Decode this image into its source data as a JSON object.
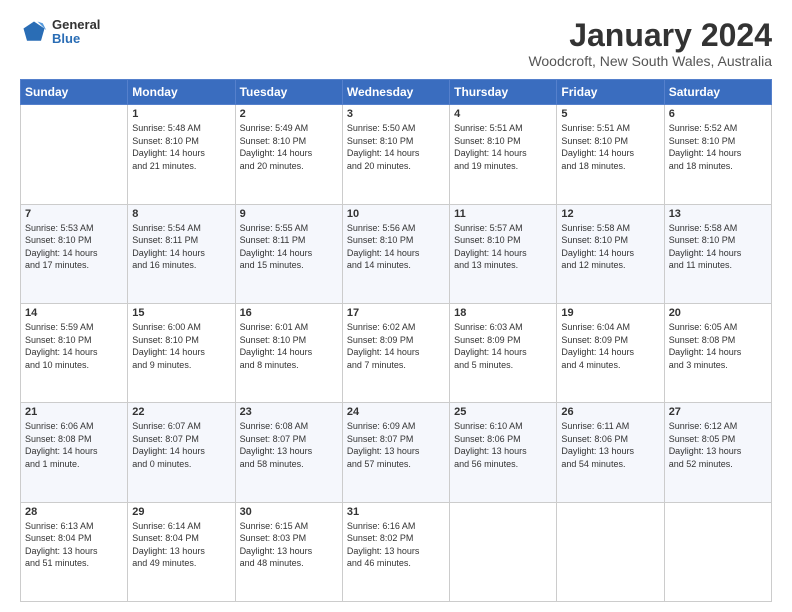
{
  "header": {
    "logo": {
      "general": "General",
      "blue": "Blue"
    },
    "title": "January 2024",
    "subtitle": "Woodcroft, New South Wales, Australia"
  },
  "weekdays": [
    "Sunday",
    "Monday",
    "Tuesday",
    "Wednesday",
    "Thursday",
    "Friday",
    "Saturday"
  ],
  "weeks": [
    [
      {
        "day": "",
        "info": ""
      },
      {
        "day": "1",
        "info": "Sunrise: 5:48 AM\nSunset: 8:10 PM\nDaylight: 14 hours\nand 21 minutes."
      },
      {
        "day": "2",
        "info": "Sunrise: 5:49 AM\nSunset: 8:10 PM\nDaylight: 14 hours\nand 20 minutes."
      },
      {
        "day": "3",
        "info": "Sunrise: 5:50 AM\nSunset: 8:10 PM\nDaylight: 14 hours\nand 20 minutes."
      },
      {
        "day": "4",
        "info": "Sunrise: 5:51 AM\nSunset: 8:10 PM\nDaylight: 14 hours\nand 19 minutes."
      },
      {
        "day": "5",
        "info": "Sunrise: 5:51 AM\nSunset: 8:10 PM\nDaylight: 14 hours\nand 18 minutes."
      },
      {
        "day": "6",
        "info": "Sunrise: 5:52 AM\nSunset: 8:10 PM\nDaylight: 14 hours\nand 18 minutes."
      }
    ],
    [
      {
        "day": "7",
        "info": "Sunrise: 5:53 AM\nSunset: 8:10 PM\nDaylight: 14 hours\nand 17 minutes."
      },
      {
        "day": "8",
        "info": "Sunrise: 5:54 AM\nSunset: 8:11 PM\nDaylight: 14 hours\nand 16 minutes."
      },
      {
        "day": "9",
        "info": "Sunrise: 5:55 AM\nSunset: 8:11 PM\nDaylight: 14 hours\nand 15 minutes."
      },
      {
        "day": "10",
        "info": "Sunrise: 5:56 AM\nSunset: 8:10 PM\nDaylight: 14 hours\nand 14 minutes."
      },
      {
        "day": "11",
        "info": "Sunrise: 5:57 AM\nSunset: 8:10 PM\nDaylight: 14 hours\nand 13 minutes."
      },
      {
        "day": "12",
        "info": "Sunrise: 5:58 AM\nSunset: 8:10 PM\nDaylight: 14 hours\nand 12 minutes."
      },
      {
        "day": "13",
        "info": "Sunrise: 5:58 AM\nSunset: 8:10 PM\nDaylight: 14 hours\nand 11 minutes."
      }
    ],
    [
      {
        "day": "14",
        "info": "Sunrise: 5:59 AM\nSunset: 8:10 PM\nDaylight: 14 hours\nand 10 minutes."
      },
      {
        "day": "15",
        "info": "Sunrise: 6:00 AM\nSunset: 8:10 PM\nDaylight: 14 hours\nand 9 minutes."
      },
      {
        "day": "16",
        "info": "Sunrise: 6:01 AM\nSunset: 8:10 PM\nDaylight: 14 hours\nand 8 minutes."
      },
      {
        "day": "17",
        "info": "Sunrise: 6:02 AM\nSunset: 8:09 PM\nDaylight: 14 hours\nand 7 minutes."
      },
      {
        "day": "18",
        "info": "Sunrise: 6:03 AM\nSunset: 8:09 PM\nDaylight: 14 hours\nand 5 minutes."
      },
      {
        "day": "19",
        "info": "Sunrise: 6:04 AM\nSunset: 8:09 PM\nDaylight: 14 hours\nand 4 minutes."
      },
      {
        "day": "20",
        "info": "Sunrise: 6:05 AM\nSunset: 8:08 PM\nDaylight: 14 hours\nand 3 minutes."
      }
    ],
    [
      {
        "day": "21",
        "info": "Sunrise: 6:06 AM\nSunset: 8:08 PM\nDaylight: 14 hours\nand 1 minute."
      },
      {
        "day": "22",
        "info": "Sunrise: 6:07 AM\nSunset: 8:07 PM\nDaylight: 14 hours\nand 0 minutes."
      },
      {
        "day": "23",
        "info": "Sunrise: 6:08 AM\nSunset: 8:07 PM\nDaylight: 13 hours\nand 58 minutes."
      },
      {
        "day": "24",
        "info": "Sunrise: 6:09 AM\nSunset: 8:07 PM\nDaylight: 13 hours\nand 57 minutes."
      },
      {
        "day": "25",
        "info": "Sunrise: 6:10 AM\nSunset: 8:06 PM\nDaylight: 13 hours\nand 56 minutes."
      },
      {
        "day": "26",
        "info": "Sunrise: 6:11 AM\nSunset: 8:06 PM\nDaylight: 13 hours\nand 54 minutes."
      },
      {
        "day": "27",
        "info": "Sunrise: 6:12 AM\nSunset: 8:05 PM\nDaylight: 13 hours\nand 52 minutes."
      }
    ],
    [
      {
        "day": "28",
        "info": "Sunrise: 6:13 AM\nSunset: 8:04 PM\nDaylight: 13 hours\nand 51 minutes."
      },
      {
        "day": "29",
        "info": "Sunrise: 6:14 AM\nSunset: 8:04 PM\nDaylight: 13 hours\nand 49 minutes."
      },
      {
        "day": "30",
        "info": "Sunrise: 6:15 AM\nSunset: 8:03 PM\nDaylight: 13 hours\nand 48 minutes."
      },
      {
        "day": "31",
        "info": "Sunrise: 6:16 AM\nSunset: 8:02 PM\nDaylight: 13 hours\nand 46 minutes."
      },
      {
        "day": "",
        "info": ""
      },
      {
        "day": "",
        "info": ""
      },
      {
        "day": "",
        "info": ""
      }
    ]
  ]
}
